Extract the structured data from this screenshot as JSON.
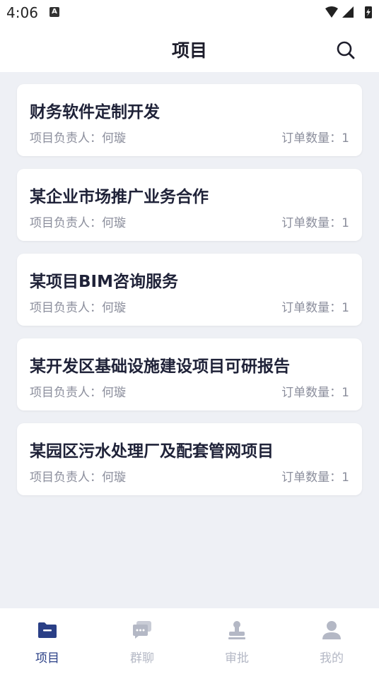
{
  "status_bar": {
    "time": "4:06",
    "notification_badge": "A"
  },
  "header": {
    "title": "项目",
    "search_icon": "search-icon"
  },
  "projects": [
    {
      "title": "财务软件定制开发",
      "owner": "项目负责人：何璇",
      "order_count": "订单数量：1"
    },
    {
      "title": "某企业市场推广业务合作",
      "owner": "项目负责人：何璇",
      "order_count": "订单数量：1"
    },
    {
      "title": "某项目BIM咨询服务",
      "owner": "项目负责人：何璇",
      "order_count": "订单数量：1"
    },
    {
      "title": "某开发区基础设施建设项目可研报告",
      "owner": "项目负责人：何璇",
      "order_count": "订单数量：1"
    },
    {
      "title": "某园区污水处理厂及配套管网项目",
      "owner": "项目负责人：何璇",
      "order_count": "订单数量：1"
    }
  ],
  "tabbar": {
    "items": [
      {
        "label": "项目",
        "icon": "folder-icon",
        "active": true
      },
      {
        "label": "群聊",
        "icon": "chat-icon",
        "active": false
      },
      {
        "label": "审批",
        "icon": "approval-icon",
        "active": false
      },
      {
        "label": "我的",
        "icon": "user-icon",
        "active": false
      }
    ]
  },
  "colors": {
    "active": "#2a3f86",
    "inactive": "#b4b8c5",
    "background": "#eef0f5"
  }
}
